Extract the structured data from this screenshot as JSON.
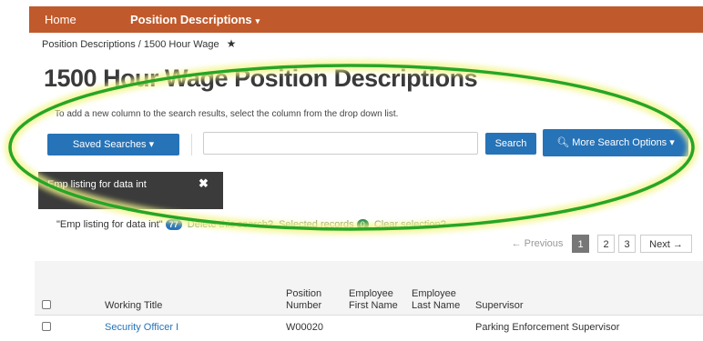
{
  "nav": {
    "home": "Home",
    "position_descriptions": "Position Descriptions",
    "caret": "▾"
  },
  "breadcrumb": {
    "text": "Position Descriptions / 1500 Hour Wage",
    "star": "★"
  },
  "page": {
    "title": "1500 Hour Wage Position Descriptions",
    "hint": "To add a new column to the search results, select the column from the drop down list."
  },
  "search": {
    "saved_searches_label": "Saved Searches",
    "saved_caret": "▾",
    "input_value": "",
    "search_label": "Search",
    "more_options_label": "More Search Options",
    "more_icon": "🔍",
    "more_caret": "▾"
  },
  "saved_tag": {
    "label": "Emp listing for data int",
    "close": "✖"
  },
  "results": {
    "search_name": "\"Emp listing for data int\"",
    "count": "77",
    "delete_text": "Delete this search?",
    "selected_text": "Selected records",
    "selected_count": "0",
    "clear_text": "Clear selection?"
  },
  "pagination": {
    "previous": "← Previous",
    "pages": [
      "1",
      "2",
      "3"
    ],
    "active_page": "1",
    "next": "Next →"
  },
  "table": {
    "headers": {
      "working_title": "Working Title",
      "position_number_1": "Position",
      "position_number_2": "Number",
      "emp_first_1": "Employee",
      "emp_first_2": "First Name",
      "emp_last_1": "Employee",
      "emp_last_2": "Last Name",
      "supervisor": "Supervisor"
    },
    "rows": [
      {
        "working_title": "Security Officer I",
        "position_number": "W00020",
        "first_name": "",
        "last_name": "",
        "supervisor": "Parking Enforcement Supervisor"
      }
    ]
  },
  "colors": {
    "nav_bg": "#c05a2c",
    "primary_button": "#2673b8",
    "highlight_ellipse": "#27a527"
  }
}
